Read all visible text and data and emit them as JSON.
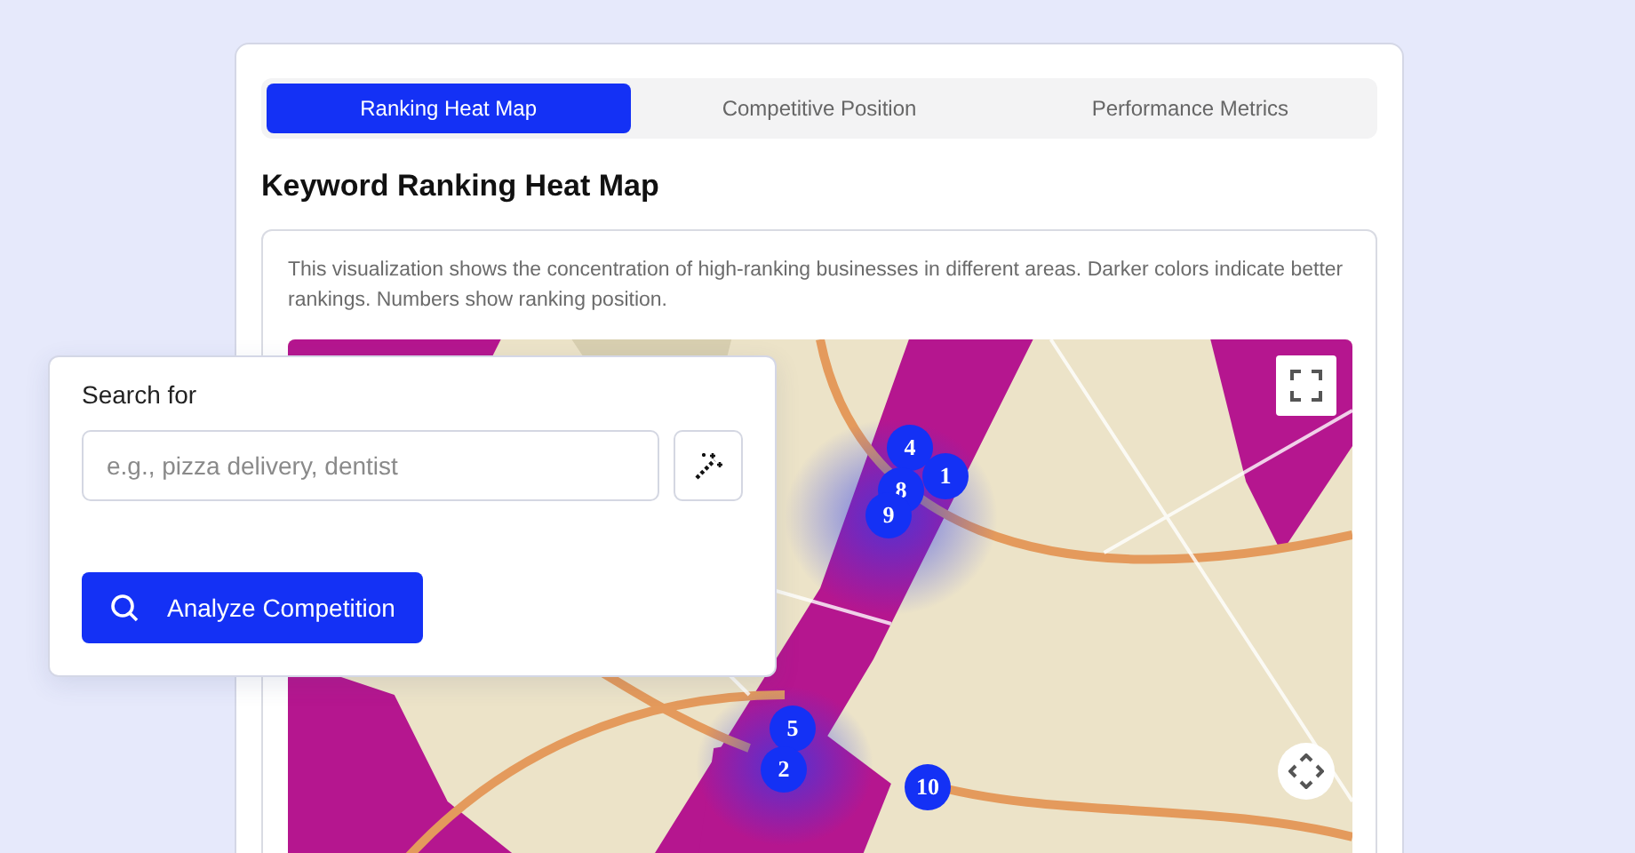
{
  "tabs": [
    {
      "label": "Ranking Heat Map",
      "selected": true
    },
    {
      "label": "Competitive Position",
      "selected": false
    },
    {
      "label": "Performance Metrics",
      "selected": false
    }
  ],
  "title": "Keyword Ranking Heat Map",
  "description": "This visualization shows the concentration of high-ranking businesses in different areas. Darker colors indicate better rankings. Numbers show ranking position.",
  "map": {
    "pins": [
      {
        "label": "4"
      },
      {
        "label": "1"
      },
      {
        "label": "8"
      },
      {
        "label": "9"
      },
      {
        "label": "5"
      },
      {
        "label": "2"
      },
      {
        "label": "10"
      }
    ]
  },
  "search_panel": {
    "label": "Search for",
    "placeholder": "e.g., pizza delivery, dentist",
    "button": "Analyze Competition"
  }
}
